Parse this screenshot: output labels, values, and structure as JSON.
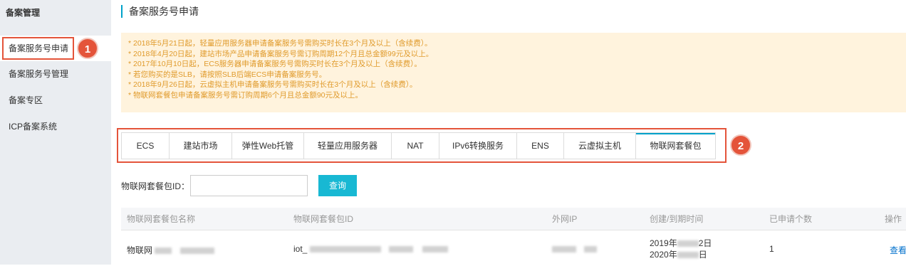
{
  "sidebar": {
    "title": "备案管理",
    "items": [
      {
        "label": "备案服务号申请"
      },
      {
        "label": "备案服务号管理"
      },
      {
        "label": "备案专区"
      },
      {
        "label": "ICP备案系统"
      }
    ]
  },
  "annotations": [
    "1",
    "2"
  ],
  "page": {
    "title": "备案服务号申请"
  },
  "notice": {
    "lines": [
      "* 2018年5月21日起，轻量应用服务器申请备案服务号需购买时长在3个月及以上（含续费）。",
      "* 2018年4月20日起，建站市场产品申请备案服务号需订购周期12个月且总金额99元及以上。",
      "* 2017年10月10日起，ECS服务器申请备案服务号需购买时长在3个月及以上（含续费）。",
      "* 若您购买的是SLB，请按照SLB后端ECS申请备案服务号。",
      "* 2018年9月26日起，云虚拟主机申请备案服务号需购买时长在3个月及以上（含续费）。",
      "* 物联网套餐包申请备案服务号需订购周期6个月且总金额90元及以上。"
    ]
  },
  "tabs": [
    {
      "label": "ECS"
    },
    {
      "label": "建站市场"
    },
    {
      "label": "弹性Web托管"
    },
    {
      "label": "轻量应用服务器"
    },
    {
      "label": "NAT"
    },
    {
      "label": "IPv6转换服务"
    },
    {
      "label": "ENS"
    },
    {
      "label": "云虚拟主机"
    },
    {
      "label": "物联网套餐包"
    }
  ],
  "active_tab": "物联网套餐包",
  "search": {
    "label": "物联网套餐包ID：",
    "value": "",
    "placeholder": "",
    "button": "查询"
  },
  "table": {
    "headers": [
      "物联网套餐包名称",
      "物联网套餐包ID",
      "外网IP",
      "创建/到期时间",
      "已申请个数",
      "操作"
    ],
    "rows": [
      {
        "name": "物联网",
        "id": "iot_",
        "ip": "",
        "created": "2019年",
        "created_tail": "2日",
        "expire": "2020年",
        "expire_tail": "日",
        "count": "1",
        "action": "查看"
      }
    ]
  },
  "colors": {
    "accent": "#00a2ca",
    "highlight": "#e4543a",
    "notice_bg": "#fff3dd",
    "notice_text": "#e09b2c",
    "sidebar_bg": "#eaedf1"
  }
}
